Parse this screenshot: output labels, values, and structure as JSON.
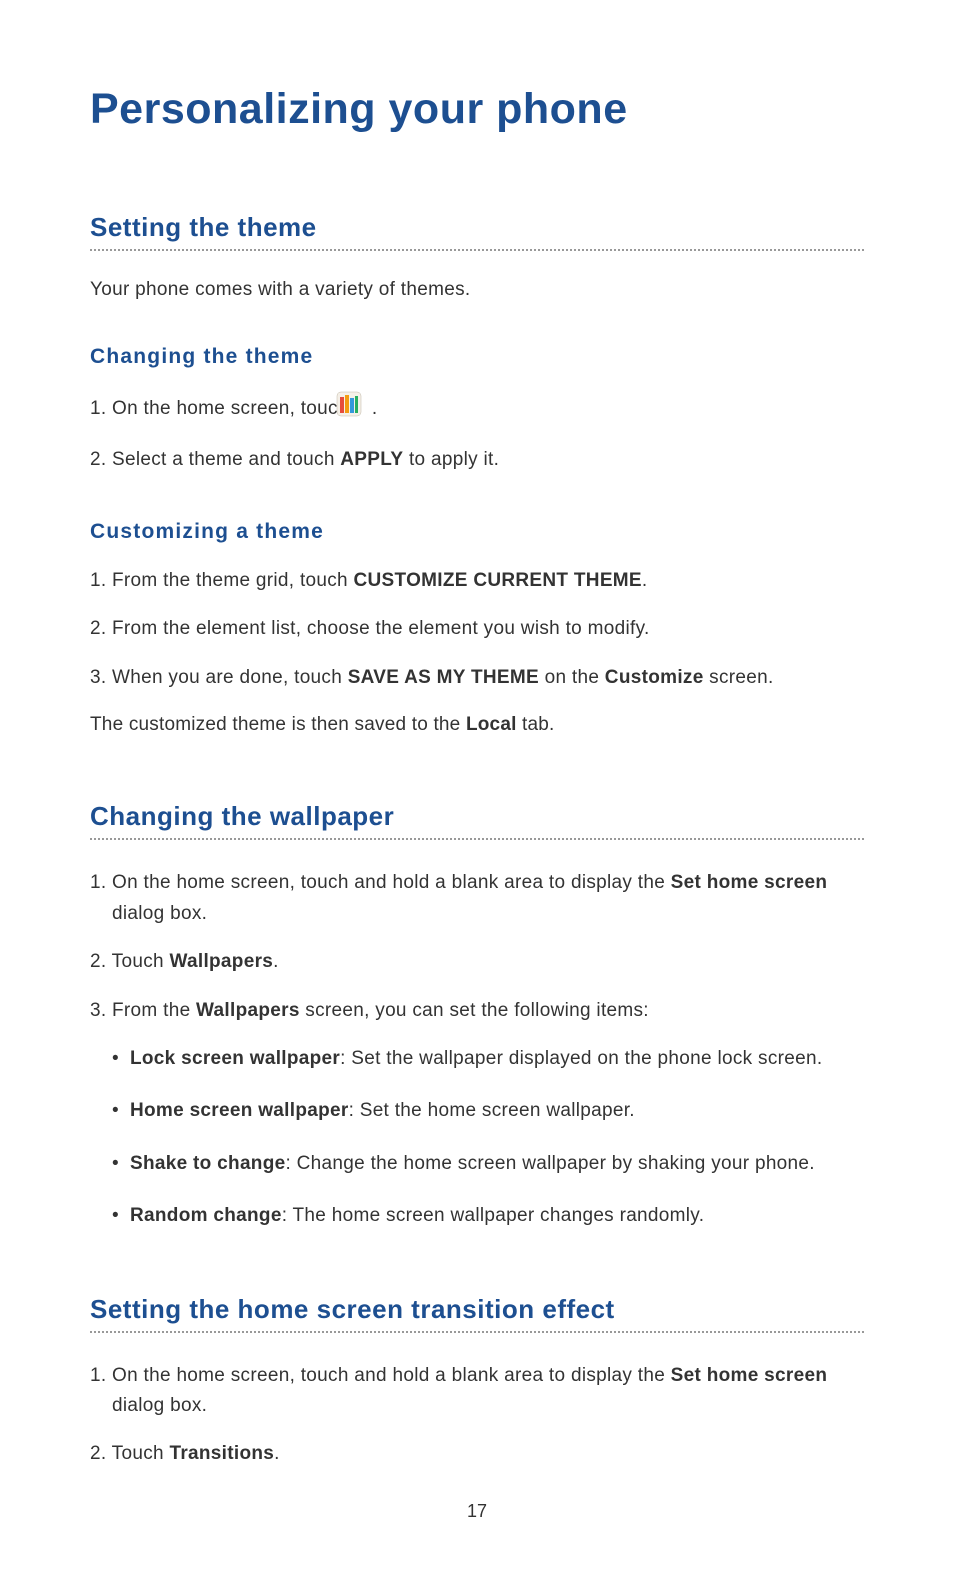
{
  "title": "Personalizing your phone",
  "page_number": "17",
  "sections": {
    "theme": {
      "heading": "Setting the theme",
      "intro": "Your phone comes with a variety of themes.",
      "changing": {
        "heading": "Changing  the  theme",
        "step1_prefix": "1. On the home screen, touch ",
        "step1_suffix": " .",
        "step2_prefix": "2. Select a theme and touch ",
        "step2_bold": "APPLY",
        "step2_suffix": " to apply it."
      },
      "customizing": {
        "heading": "Customizing  a  theme",
        "step1_prefix": "1. From the theme grid, touch ",
        "step1_bold": "CUSTOMIZE CURRENT THEME",
        "step1_suffix": ".",
        "step2": "2. From the element list, choose the element you wish to modify.",
        "step3_prefix": "3. When you are done, touch ",
        "step3_bold1": "SAVE AS MY THEME",
        "step3_mid": " on the ",
        "step3_bold2": "Customize",
        "step3_suffix": " screen.",
        "note_prefix": "The customized theme is then saved to the ",
        "note_bold": "Local",
        "note_suffix": " tab."
      }
    },
    "wallpaper": {
      "heading": "Changing the wallpaper",
      "step1_prefix": "1. On the home screen, touch and hold a blank area to display the ",
      "step1_bold": "Set home screen",
      "step1_suffix": " dialog box.",
      "step2_prefix": "2. Touch ",
      "step2_bold": "Wallpapers",
      "step2_suffix": ".",
      "step3_prefix": "3. From the ",
      "step3_bold": "Wallpapers",
      "step3_suffix": " screen, you can set the following items:",
      "bullets": {
        "b1_bold": "Lock screen wallpaper",
        "b1_text": ": Set the wallpaper displayed on the phone lock screen.",
        "b2_bold": "Home screen wallpaper",
        "b2_text": ": Set the home screen wallpaper.",
        "b3_bold": "Shake to change",
        "b3_text": ": Change the home screen wallpaper by shaking your phone.",
        "b4_bold": "Random change",
        "b4_text": ": The home screen wallpaper changes randomly."
      }
    },
    "transition": {
      "heading": "Setting the home screen transition effect",
      "step1_prefix": "1. On the home screen, touch and hold a blank area to display the ",
      "step1_bold": "Set home screen",
      "step1_suffix": " dialog box.",
      "step2_prefix": "2. Touch ",
      "step2_bold": "Transitions",
      "step2_suffix": "."
    }
  }
}
